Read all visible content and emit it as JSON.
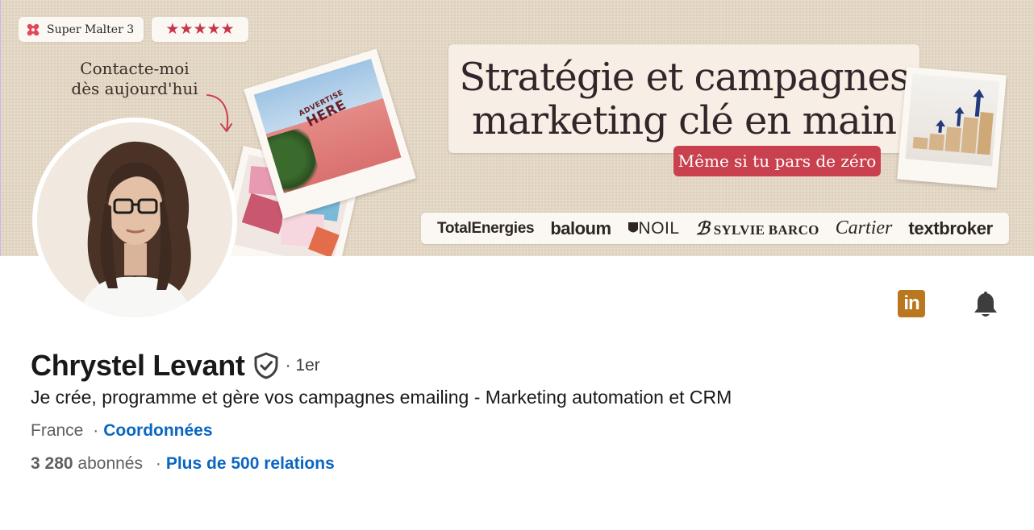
{
  "banner": {
    "malt_badge": "Super Malter 3",
    "stars": "★★★★★",
    "contact_line1": "Contacte-moi",
    "contact_line2": "dès aujourd'hui",
    "photo_sign_small": "ADVERTISE",
    "photo_sign_big": "HERE",
    "headline_line1": "Stratégie et campagnes",
    "headline_line2": "marketing clé en main",
    "subline": "Même si tu pars de zéro",
    "logos": [
      "TotalEnergies",
      "baloum",
      "NOIL",
      "SYLVIE BARCO",
      "Cartier",
      "textbroker"
    ],
    "colors": {
      "background": "#e6d8c6",
      "accent_red": "#c9414f",
      "headline_text": "#33262a"
    }
  },
  "actions": {
    "linkedin_label": "in",
    "linkedin_icon": "linkedin-icon",
    "bell_icon": "bell-icon"
  },
  "profile": {
    "name": "Chrystel Levant",
    "verified_icon": "verified-shield-icon",
    "degree": "· 1er",
    "headline": "Je crée, programme et gère vos campagnes emailing - Marketing automation et CRM",
    "location": "France",
    "location_sep": "·",
    "contact_link": "Coordonnées",
    "followers_count": "3 280",
    "followers_label": "abonnés",
    "stats_sep": "·",
    "connections_link": "Plus de 500 relations"
  },
  "colors": {
    "link": "#0a66c2",
    "linkedin_button": "#b9771f",
    "text_primary": "#191919",
    "text_secondary": "#5f5f5f"
  }
}
